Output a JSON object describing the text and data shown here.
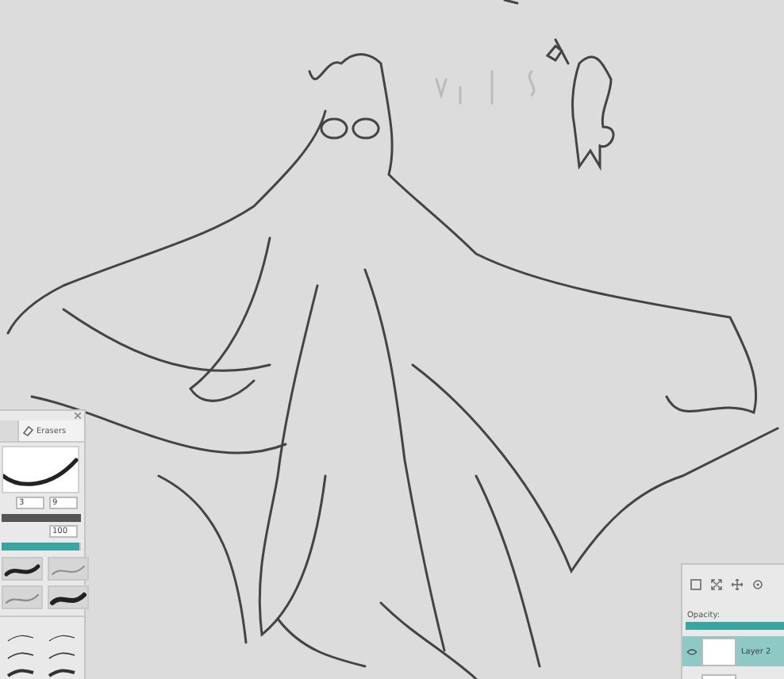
{
  "brush_panel": {
    "tab": {
      "label": "Erasers",
      "selected": true
    },
    "size_fields": [
      {
        "value": "3"
      },
      {
        "value": "9"
      }
    ],
    "size_slider": {
      "level": 1
    },
    "opacity_field": {
      "value": "100"
    },
    "opacity_slider": {
      "level": 0.98
    }
  },
  "layers_panel": {
    "opacity_label": "Opacity:",
    "opacity_slider": {
      "level": 1
    },
    "layers": [
      {
        "name": "Layer 2",
        "selected": true
      },
      {
        "selected": false
      }
    ]
  }
}
